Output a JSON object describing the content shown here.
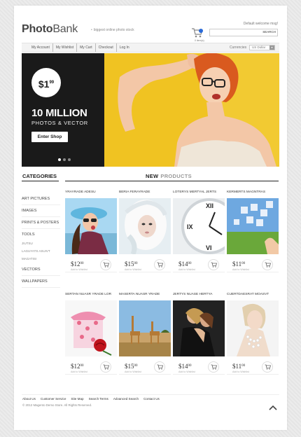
{
  "header": {
    "logo_bold": "Photo",
    "logo_light": "Bank",
    "tagline": "biggest online photo stock",
    "welcome": "Default welcome msg!",
    "cart_label": "0 item(s)",
    "search_button": "SEARCH",
    "search_placeholder": ""
  },
  "topnav": {
    "items": [
      "My Account",
      "My Wishlist",
      "My Cart",
      "Checkout",
      "Log In"
    ],
    "currency_label": "Currencies",
    "currency_value": "US Dollar"
  },
  "banner": {
    "price_main": "$1",
    "price_cents": "99",
    "title": "10 MILLION",
    "subtitle": "PHOTOS & VECTOR",
    "button": "Enter Shop",
    "slides": 3,
    "active_slide": 1,
    "colors": {
      "left_bg": "#1a1a1a",
      "right_bg": "#f0c322"
    }
  },
  "categories": {
    "heading": "CATEGORIES",
    "items": [
      {
        "label": "ART PICTURES",
        "type": "main"
      },
      {
        "label": "IMAGES",
        "type": "main"
      },
      {
        "label": "PRINTS & POSTERS",
        "type": "main"
      },
      {
        "label": "TOOLS",
        "type": "main",
        "expanded": true
      },
      {
        "label": "JIUTSU",
        "type": "sub"
      },
      {
        "label": "LAGUYATS ASUIVT",
        "type": "sub"
      },
      {
        "label": "MAGATISI",
        "type": "sub"
      },
      {
        "label": "VECTORS",
        "type": "main"
      },
      {
        "label": "WALLPAPERS",
        "type": "main"
      }
    ]
  },
  "new_products": {
    "heading_bold": "NEW",
    "heading_light": "PRODUCTS",
    "wishlist_label": "Add to Wishlist",
    "items": [
      {
        "name": "YRAYRADE ADESU",
        "price": "$12",
        "cents": "00",
        "image": "woman-hat-glasses"
      },
      {
        "name": "BERIA FERAYRADE",
        "price": "$15",
        "cents": "00",
        "image": "woman-white-feathers"
      },
      {
        "name": "LOTERYS MERTYAL JERTS",
        "price": "$14",
        "cents": "00",
        "image": "wall-clock"
      },
      {
        "name": "KERMERTS MAGNTRAS",
        "price": "$11",
        "cents": "00",
        "image": "puzzle-sky"
      },
      {
        "name": "SERTAN NUASR YRADE LOR",
        "price": "$12",
        "cents": "00",
        "image": "gift-box-rose"
      },
      {
        "name": "MASERTA NUASR YRADE",
        "price": "$15",
        "cents": "00",
        "image": "giraffes-savanna"
      },
      {
        "name": "JERTYS NUASE HERTYA",
        "price": "$14",
        "cents": "00",
        "image": "couple-dancing"
      },
      {
        "name": "CUERTDAESRAT MOASVT",
        "price": "$11",
        "cents": "00",
        "image": "woman-pearls"
      }
    ]
  },
  "footer": {
    "links": [
      "About Us",
      "Customer Service",
      "Site Map",
      "Search Terms",
      "Advanced Search",
      "Contact Us"
    ],
    "copyright": "© 2012 Magento Demo Store. All Rights Reserved."
  }
}
